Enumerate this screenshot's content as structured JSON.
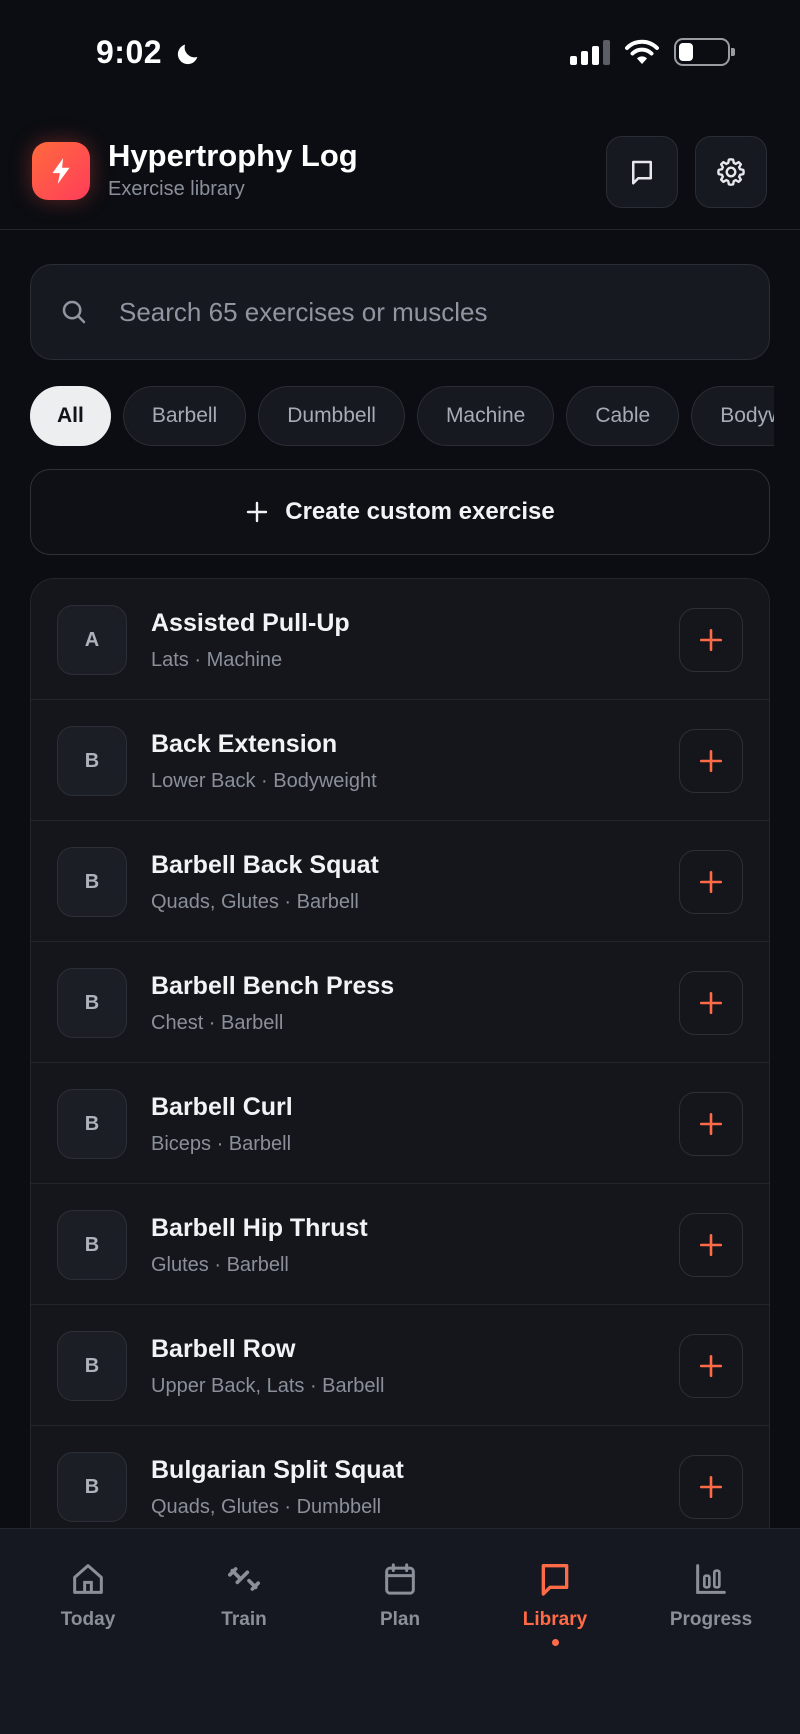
{
  "status": {
    "time": "9:02"
  },
  "header": {
    "title": "Hypertrophy Log",
    "subtitle": "Exercise library"
  },
  "search": {
    "placeholder": "Search 65 exercises or muscles",
    "value": ""
  },
  "filters": [
    "All",
    "Barbell",
    "Dumbbell",
    "Machine",
    "Cable",
    "Bodyweight"
  ],
  "create": {
    "label": "Create custom exercise"
  },
  "exercises": [
    {
      "initial": "A",
      "name": "Assisted Pull-Up",
      "meta": "Lats · Machine"
    },
    {
      "initial": "B",
      "name": "Back Extension",
      "meta": "Lower Back · Bodyweight"
    },
    {
      "initial": "B",
      "name": "Barbell Back Squat",
      "meta": "Quads, Glutes · Barbell"
    },
    {
      "initial": "B",
      "name": "Barbell Bench Press",
      "meta": "Chest · Barbell"
    },
    {
      "initial": "B",
      "name": "Barbell Curl",
      "meta": "Biceps · Barbell"
    },
    {
      "initial": "B",
      "name": "Barbell Hip Thrust",
      "meta": "Glutes · Barbell"
    },
    {
      "initial": "B",
      "name": "Barbell Row",
      "meta": "Upper Back, Lats · Barbell"
    },
    {
      "initial": "B",
      "name": "Bulgarian Split Squat",
      "meta": "Quads, Glutes · Dumbbell"
    }
  ],
  "nav": [
    {
      "label": "Today",
      "icon": "home-icon"
    },
    {
      "label": "Train",
      "icon": "dumbbell-icon"
    },
    {
      "label": "Plan",
      "icon": "calendar-icon"
    },
    {
      "label": "Library",
      "icon": "book-icon",
      "active": true
    },
    {
      "label": "Progress",
      "icon": "bar-chart-icon"
    }
  ],
  "colors": {
    "accent": "#ff6b47",
    "background": "#0b0d12",
    "surface": "#14161c"
  }
}
